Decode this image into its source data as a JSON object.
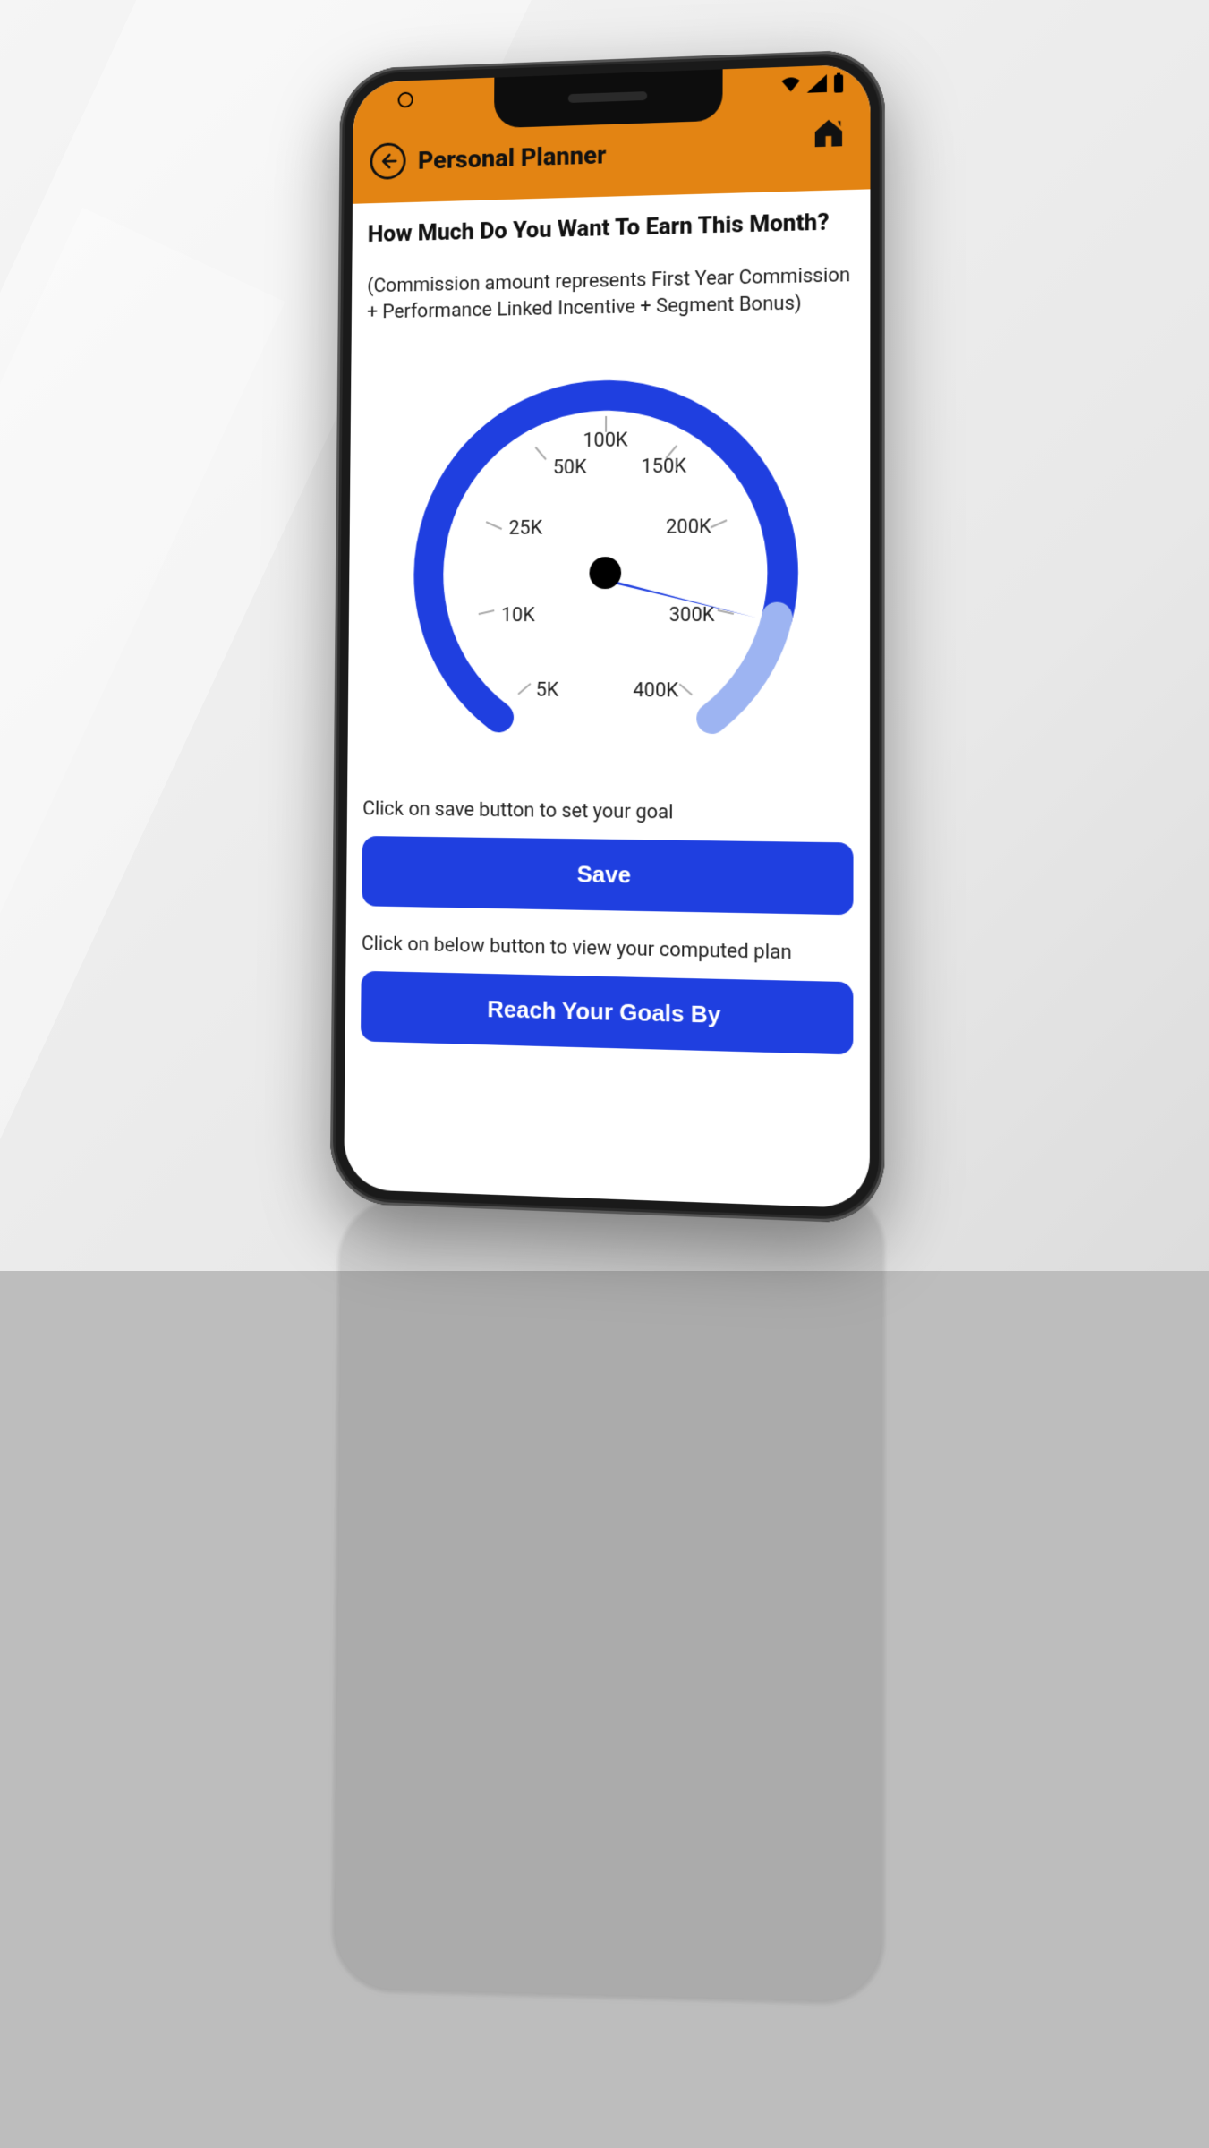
{
  "status_bar": {
    "signal_icon": "signal-icon",
    "wifi_icon": "wifi-icon",
    "battery_icon": "battery-icon"
  },
  "app_bar": {
    "title": "Personal Planner",
    "back_icon": "back-arrow-icon",
    "home_icon": "home-icon"
  },
  "main": {
    "heading": "How Much Do You Want To Earn This Month?",
    "subtext": "(Commission amount represents First Year Commission + Performance Linked Incentive + Segment Bonus)",
    "save_hint": "Click on save button to set your goal",
    "save_label": "Save",
    "plan_hint": "Click on below button to view your computed plan",
    "plan_label": "Reach Your Goals By"
  },
  "chart_data": {
    "type": "gauge",
    "ticks": [
      "5K",
      "10K",
      "25K",
      "50K",
      "100K",
      "150K",
      "200K",
      "300K",
      "400K"
    ],
    "selected_value": "300K",
    "min_label": "5K",
    "max_label": "400K",
    "arc_color": "#1f3fe0",
    "arc_remaining_color": "#9db4f2",
    "needle_color": "#1f3fe0"
  }
}
